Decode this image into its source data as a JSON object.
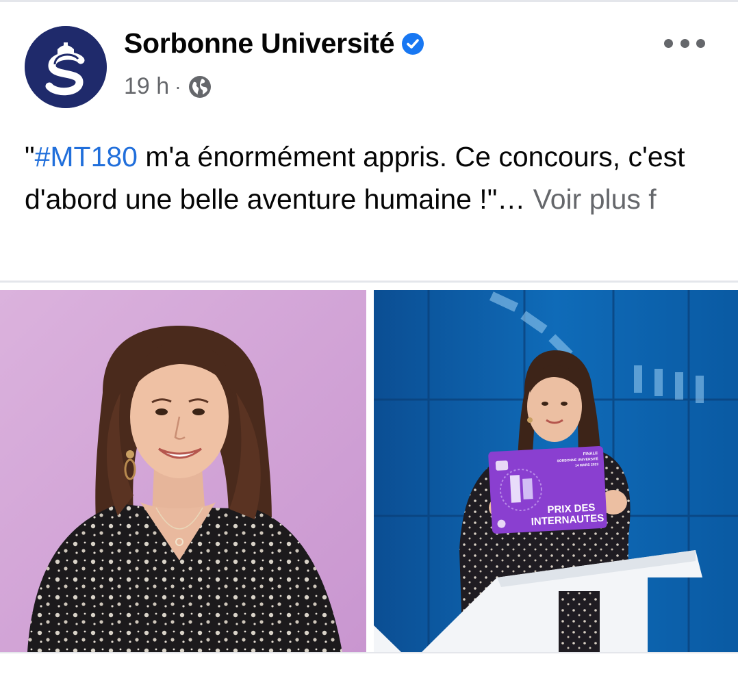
{
  "post": {
    "author": "Sorbonne Université",
    "verified": true,
    "timestamp": "19 h",
    "separator": "·",
    "audience_icon": "globe-icon",
    "more_icon": "more-horizontal-icon",
    "text_open_quote": "\"",
    "hashtag": "#MT180",
    "text_body": " m'a énormément appris. Ce concours, c'est d'abord une belle aventure humaine !\"… ",
    "see_more": "Voir plus f"
  },
  "photos": {
    "left": {
      "subject": "portrait-photo"
    },
    "right": {
      "subject": "award-photo",
      "sign_small_1": "FINALE",
      "sign_small_2": "SORBONNE UNIVERSITÉ",
      "sign_small_3": "14 MARS 2023",
      "sign_line1": "PRIX DES",
      "sign_line2": "INTERNAUTES"
    }
  },
  "colors": {
    "hashtag": "#216fdb",
    "verified": "#1877f2",
    "meta": "#65676b",
    "brand_navy": "#1f2a6b",
    "sign_purple": "#8a3fd0"
  }
}
